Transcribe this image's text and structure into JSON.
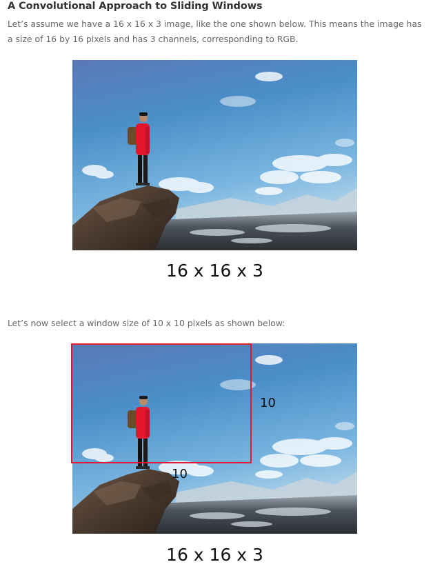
{
  "section": {
    "heading": "A Convolutional Approach to Sliding Windows",
    "para1": "Let’s assume we have a 16 x 16 x 3 image, like the one shown below. This means the image has a size of 16 by 16 pixels and has 3 channels, corresponding to RGB.",
    "para2": "Let’s now select a window size of 10 x 10 pixels as shown below:"
  },
  "figure1": {
    "caption": "16 x 16 x 3",
    "icon": "hiker-on-cliff-photo"
  },
  "figure2": {
    "caption": "16 x 16 x 3",
    "window_width_label": "10",
    "window_height_label": "10",
    "window_color": "#e0182d",
    "icon": "hiker-on-cliff-photo"
  }
}
